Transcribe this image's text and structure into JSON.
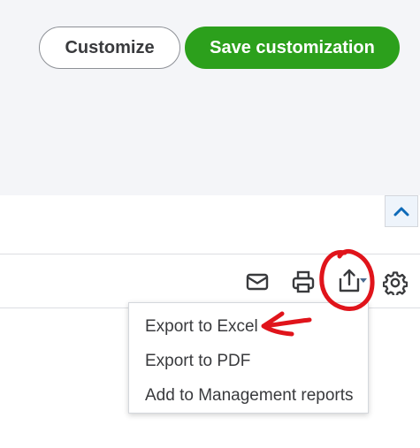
{
  "header": {
    "customize_label": "Customize",
    "save_label": "Save customization"
  },
  "toolbar": {
    "icons": [
      "email-icon",
      "print-icon",
      "export-icon",
      "settings-icon"
    ]
  },
  "export_menu": {
    "items": [
      {
        "label": "Export to Excel"
      },
      {
        "label": "Export to PDF"
      },
      {
        "label": "Add to Management reports"
      }
    ]
  },
  "colors": {
    "save_green": "#2ca01c",
    "annotation_red": "#e0141b",
    "text_dark": "#393a3d",
    "chevron_blue": "#0d6ab8"
  }
}
